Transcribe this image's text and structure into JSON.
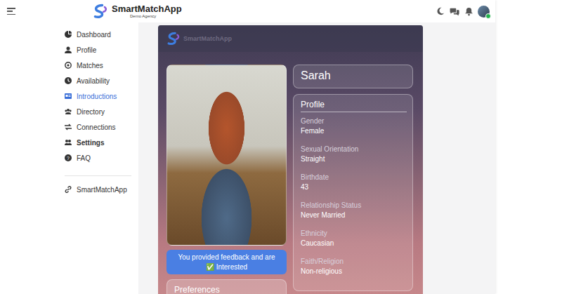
{
  "header": {
    "logo_title": "SmartMatchApp",
    "logo_subtitle": "Demo Agency",
    "user": {
      "online": true,
      "color": "#22b14c"
    }
  },
  "sidebar": {
    "items": [
      {
        "label": "Dashboard",
        "selected": false,
        "bold": false
      },
      {
        "label": "Profile",
        "selected": false,
        "bold": false
      },
      {
        "label": "Matches",
        "selected": false,
        "bold": false
      },
      {
        "label": "Availability",
        "selected": false,
        "bold": false
      },
      {
        "label": "Introductions",
        "selected": true,
        "bold": false
      },
      {
        "label": "Directory",
        "selected": false,
        "bold": false
      },
      {
        "label": "Connections",
        "selected": false,
        "bold": false
      },
      {
        "label": "Settings",
        "selected": false,
        "bold": true
      },
      {
        "label": "FAQ",
        "selected": false,
        "bold": false
      }
    ],
    "footer_item": {
      "label": "SmartMatchApp"
    }
  },
  "card": {
    "brand": "SmartMatchApp",
    "feedback": {
      "line1": "You provided feedback and are",
      "line2": "✅ Interested"
    },
    "preferences_title": "Preferences",
    "name": "Sarah",
    "profile": {
      "title": "Profile",
      "fields": [
        {
          "label": "Gender",
          "value": "Female"
        },
        {
          "label": "Sexual Orientation",
          "value": "Straight"
        },
        {
          "label": "Birthdate",
          "value": "43"
        },
        {
          "label": "Relationship Status",
          "value": "Never Married"
        },
        {
          "label": "Ethnicity",
          "value": "Caucasian"
        },
        {
          "label": "Faith/Religion",
          "value": "Non-religious"
        }
      ]
    }
  }
}
